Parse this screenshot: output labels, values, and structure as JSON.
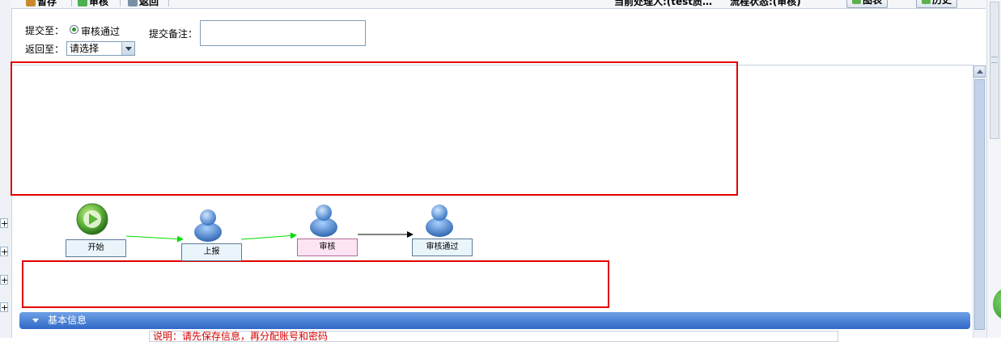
{
  "toolbar": {
    "save_label": "暂存",
    "audit_label": "审核",
    "back_label": "返回",
    "current_handler": "当前处理人:(test质…",
    "flow_status": "流程状态:(审核)",
    "chart_label": "图表",
    "history_label": "历史"
  },
  "form": {
    "submit_to_label": "提交至：",
    "submit_option": "审核通过",
    "return_to_label": "返回至：",
    "return_select_value": "请选择",
    "remark_label": "提交备注："
  },
  "workflow": {
    "nodes": [
      {
        "label": "开始",
        "icon": "start-play-icon"
      },
      {
        "label": "上报",
        "icon": "person-icon"
      },
      {
        "label": "审核",
        "icon": "person-icon",
        "current": true
      },
      {
        "label": "审核通过",
        "icon": "person-icon"
      }
    ]
  },
  "panel": {
    "title": "基本信息",
    "notice": "说明：请先保存信息，再分配账号和密码"
  },
  "colors": {
    "highlight_red": "#e00000",
    "active_edge_green": "#00dd00",
    "current_node_pink": "#fde4f3"
  }
}
